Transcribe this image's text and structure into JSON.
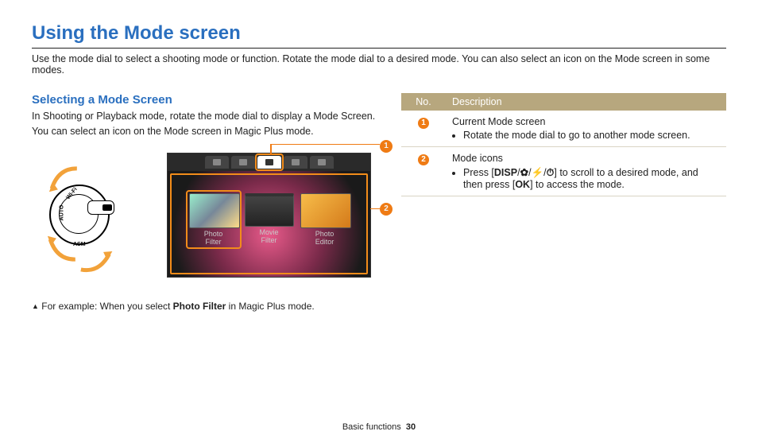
{
  "page": {
    "title": "Using the Mode screen",
    "intro": "Use the mode dial to select a shooting mode or function. Rotate the mode dial to a desired mode. You can also select an icon on the Mode screen in some modes.",
    "footer_section": "Basic functions",
    "footer_page": "30"
  },
  "left": {
    "heading": "Selecting a Mode Screen",
    "p1": "In Shooting or Playback mode, rotate the mode dial to display a Mode Screen.",
    "p2": "You can select an icon on the Mode screen in Magic Plus mode.",
    "dial": {
      "label_auto": "AUTO",
      "label_asm": "ASM",
      "label_wifi": "Wi-Fi"
    },
    "callouts": {
      "c1": "1",
      "c2": "2"
    },
    "cards": [
      {
        "line1": "Photo",
        "line2": "Filter"
      },
      {
        "line1": "Movie",
        "line2": "Filter"
      },
      {
        "line1": "Photo",
        "line2": "Editor"
      }
    ],
    "caption_prefix": "For example: When you select ",
    "caption_bold": "Photo Filter",
    "caption_suffix": " in Magic Plus mode."
  },
  "table": {
    "head_no": "No.",
    "head_desc": "Description",
    "rows": [
      {
        "num": "1",
        "title": "Current Mode screen",
        "bullet": "Rotate the mode dial to go to another mode screen."
      },
      {
        "num": "2",
        "title": "Mode icons",
        "bullet_pre": "Press [",
        "key1": "DISP",
        "sep": "/",
        "key2_icon": "flower-icon",
        "key3_icon": "flash-icon",
        "key4_icon": "timer-icon",
        "bullet_mid": "] to scroll to a desired mode, and then press [",
        "key_ok": "OK",
        "bullet_post": "] to access the mode."
      }
    ]
  }
}
